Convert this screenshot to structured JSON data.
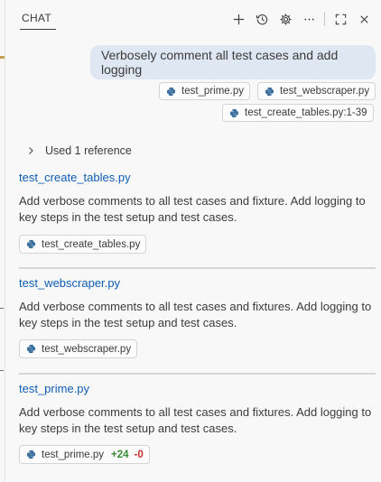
{
  "header": {
    "tab_label": "CHAT",
    "icons": [
      "plus-icon",
      "history-icon",
      "gear-icon",
      "ellipsis-icon",
      "maximize-icon",
      "close-icon"
    ]
  },
  "user_message": {
    "text": "Verbosely comment all test cases and add logging",
    "attachments": [
      "test_prime.py",
      "test_webscraper.py",
      "test_create_tables.py:1-39"
    ]
  },
  "references": {
    "label": "Used 1 reference"
  },
  "edits": [
    {
      "file": "test_create_tables.py",
      "description": "Add verbose comments to all test cases and fixture. Add logging to key steps in the test setup and test cases.",
      "chip": "test_create_tables.py"
    },
    {
      "file": "test_webscraper.py",
      "description": "Add verbose comments to all test cases and fixtures. Add logging to key steps in the test setup and test cases.",
      "chip": "test_webscraper.py"
    },
    {
      "file": "test_prime.py",
      "description": "Add verbose comments to all test cases and fixtures. Add logging to key steps in the test setup and test cases.",
      "chip": "test_prime.py",
      "added": "+24",
      "removed": "-0"
    }
  ],
  "colors": {
    "link": "#0f5db3",
    "bubble": "#dfe7f2",
    "python_icon": "#3a6f9e",
    "diff_add": "#388a34",
    "diff_del": "#c72e2e"
  }
}
